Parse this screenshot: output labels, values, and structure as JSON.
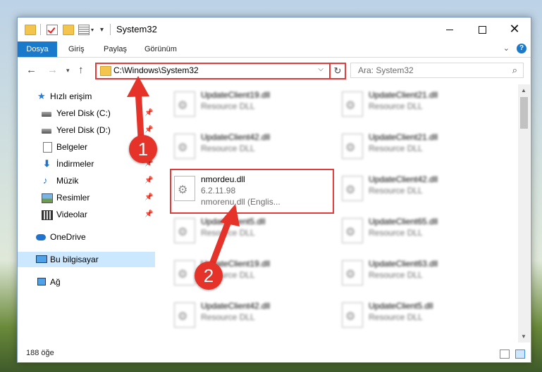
{
  "window": {
    "title": "System32"
  },
  "ribbon": {
    "tabs": [
      "Dosya",
      "Giriş",
      "Paylaş",
      "Görünüm"
    ],
    "help": "?"
  },
  "address": {
    "path": "C:\\Windows\\System32",
    "search_placeholder": "Ara: System32"
  },
  "nav": {
    "items": [
      {
        "label": "Hızlı erişim",
        "icon": "star-icon"
      },
      {
        "label": "Yerel Disk (C:)",
        "icon": "drive-icon",
        "pinned": true
      },
      {
        "label": "Yerel Disk (D:)",
        "icon": "drive-icon",
        "pinned": true
      },
      {
        "label": "Belgeler",
        "icon": "documents-icon",
        "pinned": true
      },
      {
        "label": "İndirmeler",
        "icon": "download-icon",
        "pinned": true
      },
      {
        "label": "Müzik",
        "icon": "music-icon",
        "pinned": true
      },
      {
        "label": "Resimler",
        "icon": "pictures-icon",
        "pinned": true
      },
      {
        "label": "Videolar",
        "icon": "videos-icon",
        "pinned": true
      },
      {
        "label": "OneDrive",
        "icon": "cloud-icon"
      },
      {
        "label": "Bu bilgisayar",
        "icon": "computer-icon",
        "selected": true
      },
      {
        "label": "Ağ",
        "icon": "network-icon"
      }
    ]
  },
  "files": [
    {
      "name": "UpdateClient19.dll",
      "desc": "Resource DLL"
    },
    {
      "name": "UpdateClient21.dll",
      "desc": "Resource DLL"
    },
    {
      "name": "UpdateClient42.dll",
      "desc": "Resource DLL"
    },
    {
      "name": "UpdateClient21.dll",
      "desc": "Resource DLL"
    },
    {
      "name": "nmordeu.dll",
      "desc": "6.2.11.98",
      "desc2": "nmorenu.dll (Englis...",
      "highlighted": true
    },
    {
      "name": "UpdateClient42.dll",
      "desc": "Resource DLL"
    },
    {
      "name": "UpdateClient5.dll",
      "desc": "Resource DLL"
    },
    {
      "name": "UpdateClient65.dll",
      "desc": "Resource DLL"
    },
    {
      "name": "UpdateClient19.dll",
      "desc": "Resource DLL"
    },
    {
      "name": "UpdateClient63.dll",
      "desc": "Resource DLL"
    },
    {
      "name": "UpdateClient42.dll",
      "desc": "Resource DLL"
    },
    {
      "name": "UpdateClient5.dll",
      "desc": "Resource DLL"
    }
  ],
  "status": {
    "count": "188 öğe"
  },
  "annotations": {
    "badge1": "1",
    "badge2": "2",
    "color": "#e5332a"
  }
}
